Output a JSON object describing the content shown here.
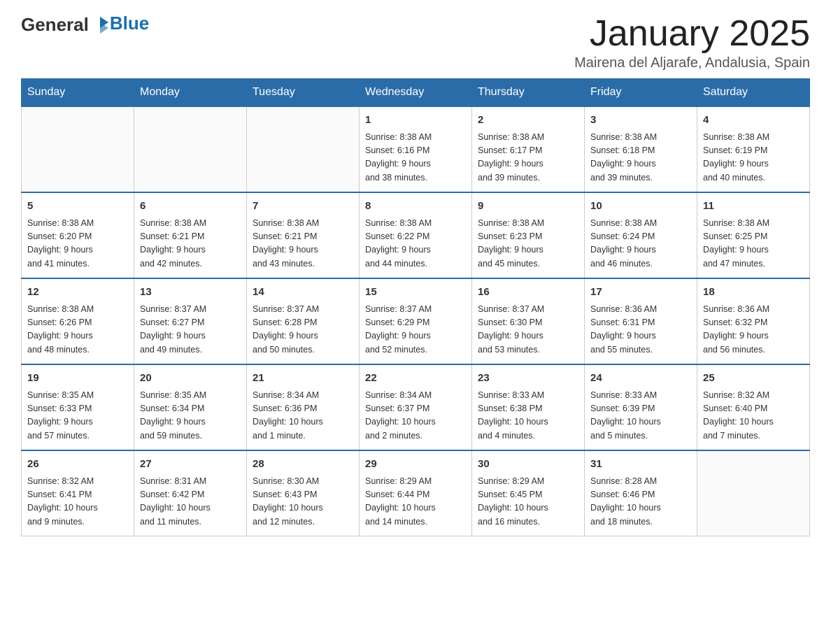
{
  "header": {
    "logo": {
      "text_general": "General",
      "text_blue": "Blue",
      "tagline": "GeneralBlue"
    },
    "month_title": "January 2025",
    "location": "Mairena del Aljarafe, Andalusia, Spain"
  },
  "calendar": {
    "days_of_week": [
      "Sunday",
      "Monday",
      "Tuesday",
      "Wednesday",
      "Thursday",
      "Friday",
      "Saturday"
    ],
    "weeks": [
      [
        {
          "day": "",
          "info": ""
        },
        {
          "day": "",
          "info": ""
        },
        {
          "day": "",
          "info": ""
        },
        {
          "day": "1",
          "info": "Sunrise: 8:38 AM\nSunset: 6:16 PM\nDaylight: 9 hours\nand 38 minutes."
        },
        {
          "day": "2",
          "info": "Sunrise: 8:38 AM\nSunset: 6:17 PM\nDaylight: 9 hours\nand 39 minutes."
        },
        {
          "day": "3",
          "info": "Sunrise: 8:38 AM\nSunset: 6:18 PM\nDaylight: 9 hours\nand 39 minutes."
        },
        {
          "day": "4",
          "info": "Sunrise: 8:38 AM\nSunset: 6:19 PM\nDaylight: 9 hours\nand 40 minutes."
        }
      ],
      [
        {
          "day": "5",
          "info": "Sunrise: 8:38 AM\nSunset: 6:20 PM\nDaylight: 9 hours\nand 41 minutes."
        },
        {
          "day": "6",
          "info": "Sunrise: 8:38 AM\nSunset: 6:21 PM\nDaylight: 9 hours\nand 42 minutes."
        },
        {
          "day": "7",
          "info": "Sunrise: 8:38 AM\nSunset: 6:21 PM\nDaylight: 9 hours\nand 43 minutes."
        },
        {
          "day": "8",
          "info": "Sunrise: 8:38 AM\nSunset: 6:22 PM\nDaylight: 9 hours\nand 44 minutes."
        },
        {
          "day": "9",
          "info": "Sunrise: 8:38 AM\nSunset: 6:23 PM\nDaylight: 9 hours\nand 45 minutes."
        },
        {
          "day": "10",
          "info": "Sunrise: 8:38 AM\nSunset: 6:24 PM\nDaylight: 9 hours\nand 46 minutes."
        },
        {
          "day": "11",
          "info": "Sunrise: 8:38 AM\nSunset: 6:25 PM\nDaylight: 9 hours\nand 47 minutes."
        }
      ],
      [
        {
          "day": "12",
          "info": "Sunrise: 8:38 AM\nSunset: 6:26 PM\nDaylight: 9 hours\nand 48 minutes."
        },
        {
          "day": "13",
          "info": "Sunrise: 8:37 AM\nSunset: 6:27 PM\nDaylight: 9 hours\nand 49 minutes."
        },
        {
          "day": "14",
          "info": "Sunrise: 8:37 AM\nSunset: 6:28 PM\nDaylight: 9 hours\nand 50 minutes."
        },
        {
          "day": "15",
          "info": "Sunrise: 8:37 AM\nSunset: 6:29 PM\nDaylight: 9 hours\nand 52 minutes."
        },
        {
          "day": "16",
          "info": "Sunrise: 8:37 AM\nSunset: 6:30 PM\nDaylight: 9 hours\nand 53 minutes."
        },
        {
          "day": "17",
          "info": "Sunrise: 8:36 AM\nSunset: 6:31 PM\nDaylight: 9 hours\nand 55 minutes."
        },
        {
          "day": "18",
          "info": "Sunrise: 8:36 AM\nSunset: 6:32 PM\nDaylight: 9 hours\nand 56 minutes."
        }
      ],
      [
        {
          "day": "19",
          "info": "Sunrise: 8:35 AM\nSunset: 6:33 PM\nDaylight: 9 hours\nand 57 minutes."
        },
        {
          "day": "20",
          "info": "Sunrise: 8:35 AM\nSunset: 6:34 PM\nDaylight: 9 hours\nand 59 minutes."
        },
        {
          "day": "21",
          "info": "Sunrise: 8:34 AM\nSunset: 6:36 PM\nDaylight: 10 hours\nand 1 minute."
        },
        {
          "day": "22",
          "info": "Sunrise: 8:34 AM\nSunset: 6:37 PM\nDaylight: 10 hours\nand 2 minutes."
        },
        {
          "day": "23",
          "info": "Sunrise: 8:33 AM\nSunset: 6:38 PM\nDaylight: 10 hours\nand 4 minutes."
        },
        {
          "day": "24",
          "info": "Sunrise: 8:33 AM\nSunset: 6:39 PM\nDaylight: 10 hours\nand 5 minutes."
        },
        {
          "day": "25",
          "info": "Sunrise: 8:32 AM\nSunset: 6:40 PM\nDaylight: 10 hours\nand 7 minutes."
        }
      ],
      [
        {
          "day": "26",
          "info": "Sunrise: 8:32 AM\nSunset: 6:41 PM\nDaylight: 10 hours\nand 9 minutes."
        },
        {
          "day": "27",
          "info": "Sunrise: 8:31 AM\nSunset: 6:42 PM\nDaylight: 10 hours\nand 11 minutes."
        },
        {
          "day": "28",
          "info": "Sunrise: 8:30 AM\nSunset: 6:43 PM\nDaylight: 10 hours\nand 12 minutes."
        },
        {
          "day": "29",
          "info": "Sunrise: 8:29 AM\nSunset: 6:44 PM\nDaylight: 10 hours\nand 14 minutes."
        },
        {
          "day": "30",
          "info": "Sunrise: 8:29 AM\nSunset: 6:45 PM\nDaylight: 10 hours\nand 16 minutes."
        },
        {
          "day": "31",
          "info": "Sunrise: 8:28 AM\nSunset: 6:46 PM\nDaylight: 10 hours\nand 18 minutes."
        },
        {
          "day": "",
          "info": ""
        }
      ]
    ]
  }
}
